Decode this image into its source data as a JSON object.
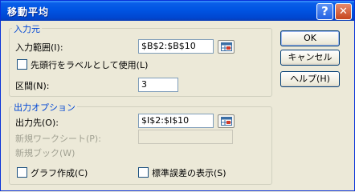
{
  "window": {
    "title": "移動平均"
  },
  "titlebar_buttons": {
    "help": "?",
    "close": "✕"
  },
  "input_group": {
    "title": "入力元",
    "input_range_label": "入力範囲(I):",
    "input_range_value": "$B$2:$B$10",
    "first_row_label": "先頭行をラベルとして使用(L)",
    "first_row_checked": false,
    "interval_label": "区間(N):",
    "interval_value": "3"
  },
  "output_group": {
    "title": "出力オプション",
    "output_label": "出力先(O):",
    "output_value": "$I$2:$I$10",
    "new_sheet_label": "新規ワークシート(P):",
    "new_sheet_value": "",
    "new_book_label": "新規ブック(W)",
    "chart_label": "グラフ作成(C)",
    "chart_checked": false,
    "stderr_label": "標準誤差の表示(S)",
    "stderr_checked": false
  },
  "buttons": {
    "ok": "OK",
    "cancel": "キャンセル",
    "help": "ヘルプ(H)"
  }
}
